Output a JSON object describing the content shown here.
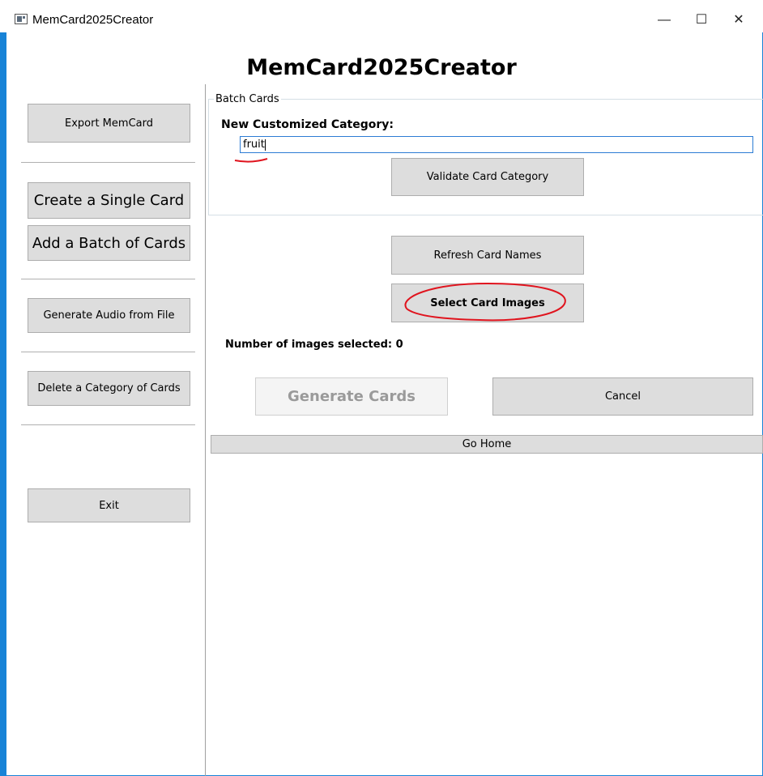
{
  "window": {
    "title": "MemCard2025Creator",
    "minimize_glyph": "—",
    "maximize_glyph": "☐",
    "close_glyph": "✕"
  },
  "header": {
    "title": "MemCard2025Creator"
  },
  "sidebar": {
    "export": "Export MemCard",
    "create_single": "Create a Single Card",
    "add_batch": "Add a Batch of Cards",
    "generate_audio": "Generate Audio from File",
    "delete_category": "Delete a Category of Cards",
    "exit": "Exit"
  },
  "batch": {
    "group_label": "Batch Cards",
    "category_label": "New Customized Category:",
    "category_value": "fruit",
    "validate_button": "Validate Card Category",
    "refresh_button": "Refresh Card Names",
    "select_images_button": "Select Card Images",
    "images_selected_label": "Number of images selected: 0",
    "generate_button": "Generate Cards",
    "cancel_button": "Cancel",
    "home_button": "Go Home"
  },
  "annotations": {
    "color": "#e0141e"
  },
  "icons": {
    "app": "app-window-icon"
  }
}
